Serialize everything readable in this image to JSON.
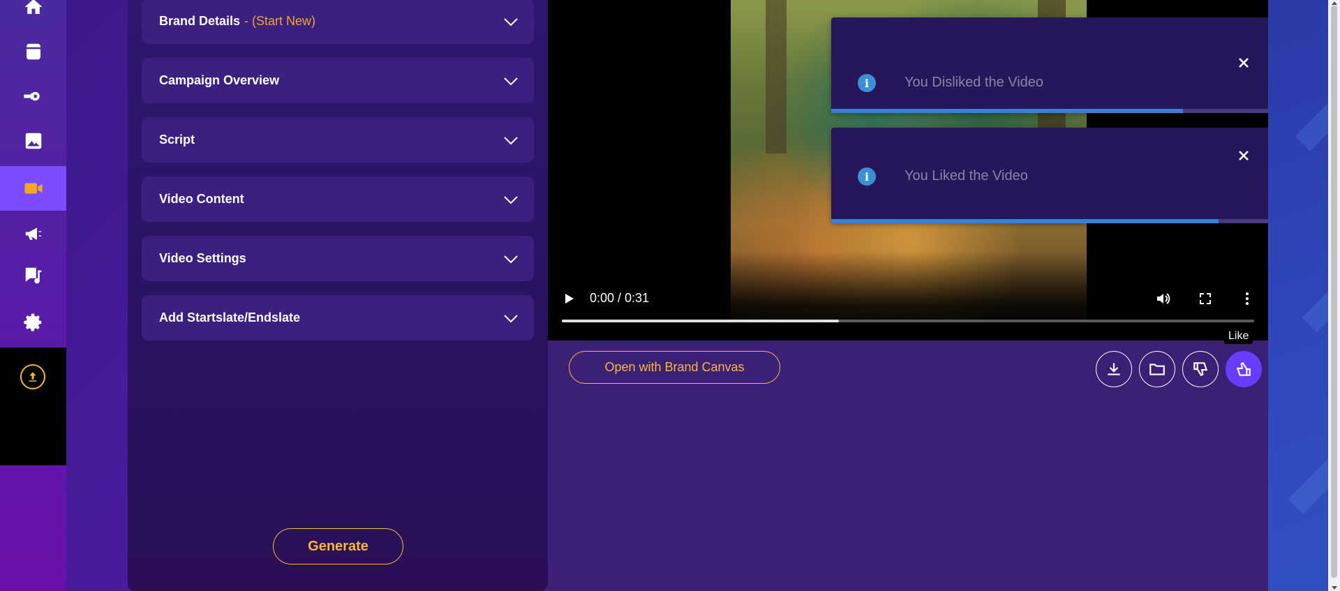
{
  "nav": {
    "items": [
      {
        "icon": "home-icon",
        "label": "Home"
      },
      {
        "icon": "archive-icon",
        "label": "Archive"
      },
      {
        "icon": "cog-arrow-icon",
        "label": "Automation"
      },
      {
        "icon": "image-icon",
        "label": "Images"
      },
      {
        "icon": "video-camera-icon",
        "label": "Video",
        "active": true
      },
      {
        "icon": "megaphone-icon",
        "label": "Campaigns"
      },
      {
        "icon": "music-note-icon",
        "label": "Audio"
      },
      {
        "icon": "gear-icon",
        "label": "Settings"
      }
    ],
    "upload_icon": "upload-icon"
  },
  "form": {
    "sections": [
      {
        "title": "Brand Details",
        "subtitle": "- (Start New)"
      },
      {
        "title": "Campaign Overview"
      },
      {
        "title": "Script"
      },
      {
        "title": "Video Content"
      },
      {
        "title": "Video Settings"
      },
      {
        "title": "Add Startslate/Endslate"
      }
    ],
    "generate_label": "Generate"
  },
  "video": {
    "time": "0:00 / 0:31",
    "progress_buffered": 0.4
  },
  "toasts": [
    {
      "message": "You Disliked the Video",
      "progress": 0.79
    },
    {
      "message": "You Liked the Video",
      "progress": 0.87
    }
  ],
  "actions": {
    "brand_canvas_label": "Open with Brand Canvas",
    "tooltip": "Like",
    "buttons": [
      "download-icon",
      "folder-icon",
      "thumbs-down-icon",
      "thumbs-up-icon"
    ]
  },
  "colors": {
    "accent": "#f5a623",
    "active_nav": "#7b4dff",
    "like_button": "#6a3cff"
  }
}
